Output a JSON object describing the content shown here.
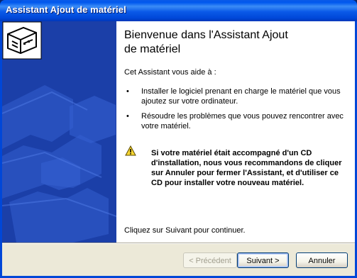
{
  "window": {
    "title": "Assistant Ajout de matériel"
  },
  "content": {
    "heading_line1": "Bienvenue dans l'Assistant Ajout",
    "heading_line2": "de matériel",
    "intro": "Cet Assistant vous aide à :",
    "bullets": [
      "Installer le logiciel prenant en charge le matériel que vous ajoutez sur votre ordinateur.",
      "Résoudre les problèmes que vous pouvez rencontrer avec votre matériel."
    ],
    "bullet_symbol": "•",
    "warning": "Si votre matériel était accompagné d'un CD d'installation, nous vous recommandons de cliquer sur Annuler pour fermer l'Assistant, et d'utiliser ce CD pour installer votre nouveau matériel.",
    "footer": "Cliquez sur Suivant pour continuer."
  },
  "buttons": {
    "back": "< Précédent",
    "next": "Suivant >",
    "cancel": "Annuler"
  },
  "icons": {
    "wizard": "hardware-card-icon",
    "warning": "warning-icon"
  },
  "colors": {
    "titlebar": "#0a5ae8",
    "side_panel": "#1b3fa8",
    "dialog_bg": "#ece9d8"
  }
}
